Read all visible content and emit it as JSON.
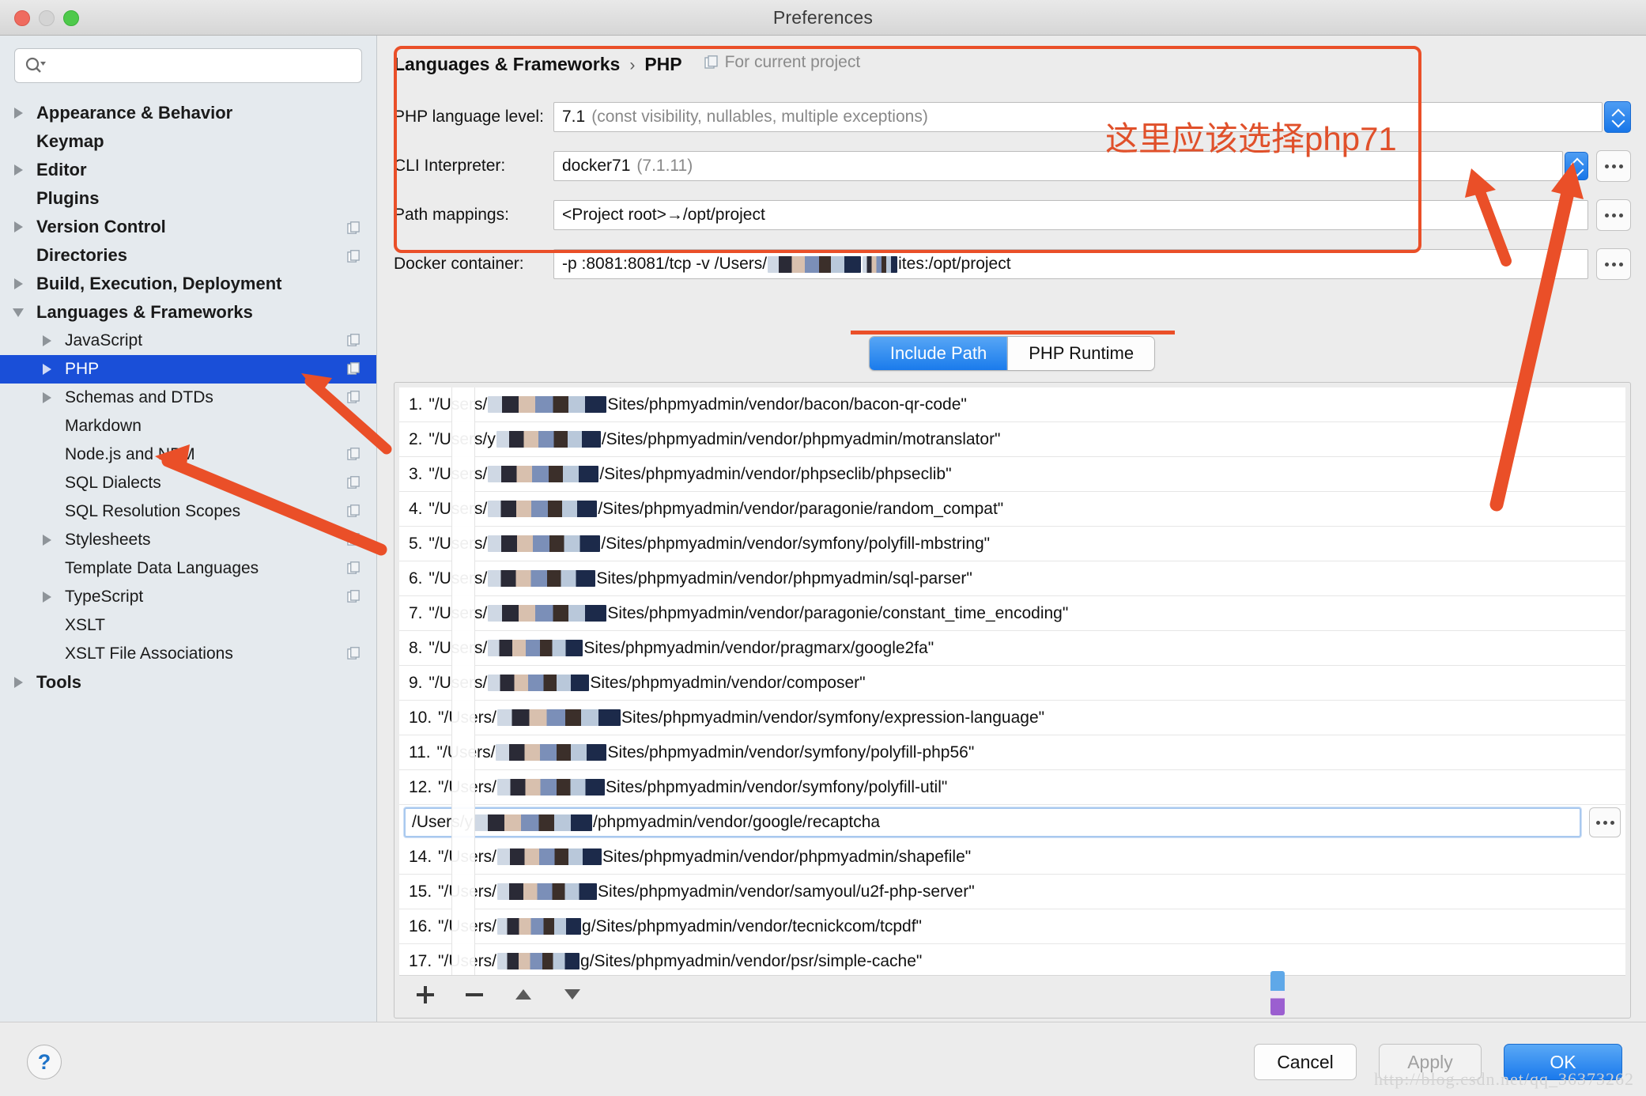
{
  "window": {
    "title": "Preferences",
    "traffic_lights": [
      "close-button",
      "minimize-button",
      "zoom-button"
    ]
  },
  "search": {
    "placeholder": "",
    "value": ""
  },
  "sidebar": {
    "items": [
      {
        "label": "Appearance & Behavior",
        "level": 0,
        "bold": true,
        "twisty": "right",
        "selected": false,
        "badge": false
      },
      {
        "label": "Keymap",
        "level": 0,
        "bold": true,
        "twisty": "none",
        "selected": false,
        "badge": false
      },
      {
        "label": "Editor",
        "level": 0,
        "bold": true,
        "twisty": "right",
        "selected": false,
        "badge": false
      },
      {
        "label": "Plugins",
        "level": 0,
        "bold": true,
        "twisty": "none",
        "selected": false,
        "badge": false
      },
      {
        "label": "Version Control",
        "level": 0,
        "bold": true,
        "twisty": "right",
        "selected": false,
        "badge": true
      },
      {
        "label": "Directories",
        "level": 0,
        "bold": true,
        "twisty": "none",
        "selected": false,
        "badge": true
      },
      {
        "label": "Build, Execution, Deployment",
        "level": 0,
        "bold": true,
        "twisty": "right",
        "selected": false,
        "badge": false
      },
      {
        "label": "Languages & Frameworks",
        "level": 0,
        "bold": true,
        "twisty": "down",
        "selected": false,
        "badge": false
      },
      {
        "label": "JavaScript",
        "level": 1,
        "bold": false,
        "twisty": "right",
        "selected": false,
        "badge": true
      },
      {
        "label": "PHP",
        "level": 1,
        "bold": false,
        "twisty": "right",
        "selected": true,
        "badge": true
      },
      {
        "label": "Schemas and DTDs",
        "level": 1,
        "bold": false,
        "twisty": "right",
        "selected": false,
        "badge": true
      },
      {
        "label": "Markdown",
        "level": 1,
        "bold": false,
        "twisty": "none",
        "selected": false,
        "badge": false
      },
      {
        "label": "Node.js and NPM",
        "level": 1,
        "bold": false,
        "twisty": "none",
        "selected": false,
        "badge": true
      },
      {
        "label": "SQL Dialects",
        "level": 1,
        "bold": false,
        "twisty": "none",
        "selected": false,
        "badge": true
      },
      {
        "label": "SQL Resolution Scopes",
        "level": 1,
        "bold": false,
        "twisty": "none",
        "selected": false,
        "badge": true
      },
      {
        "label": "Stylesheets",
        "level": 1,
        "bold": false,
        "twisty": "right",
        "selected": false,
        "badge": true
      },
      {
        "label": "Template Data Languages",
        "level": 1,
        "bold": false,
        "twisty": "none",
        "selected": false,
        "badge": true
      },
      {
        "label": "TypeScript",
        "level": 1,
        "bold": false,
        "twisty": "right",
        "selected": false,
        "badge": true
      },
      {
        "label": "XSLT",
        "level": 1,
        "bold": false,
        "twisty": "none",
        "selected": false,
        "badge": false
      },
      {
        "label": "XSLT File Associations",
        "level": 1,
        "bold": false,
        "twisty": "none",
        "selected": false,
        "badge": true
      },
      {
        "label": "Tools",
        "level": 0,
        "bold": true,
        "twisty": "right",
        "selected": false,
        "badge": false
      }
    ]
  },
  "breadcrumb": {
    "parent": "Languages & Frameworks",
    "separator": "›",
    "current": "PHP",
    "scope_note": "For current project"
  },
  "form": {
    "php_language_level": {
      "label": "PHP language level:",
      "value": "7.1",
      "value_detail": "(const visibility, nullables, multiple exceptions)"
    },
    "cli_interpreter": {
      "label": "CLI Interpreter:",
      "value": "docker71",
      "value_detail": "(7.1.11)"
    },
    "path_mappings": {
      "label": "Path mappings:",
      "value": "<Project root>→/opt/project"
    },
    "docker_container": {
      "label": "Docker container:",
      "value_prefix": "-p :8081:8081/tcp -v /Users/",
      "value_suffix": "ites:/opt/project"
    },
    "dots_label": "..."
  },
  "tabs": [
    {
      "label": "Include Path",
      "active": true
    },
    {
      "label": "PHP Runtime",
      "active": false
    }
  ],
  "include_path": {
    "rows": [
      {
        "num": "1.",
        "prefix": "\"/Users/",
        "suffix": "Sites/phpmyadmin/vendor/bacon/bacon-qr-code\"",
        "editing": false
      },
      {
        "num": "2.",
        "prefix": "\"/Users/y",
        "suffix": "/Sites/phpmyadmin/vendor/phpmyadmin/motranslator\"",
        "editing": false
      },
      {
        "num": "3.",
        "prefix": "\"/Users/",
        "suffix": "/Sites/phpmyadmin/vendor/phpseclib/phpseclib\"",
        "editing": false
      },
      {
        "num": "4.",
        "prefix": "\"/Users/",
        "suffix": "/Sites/phpmyadmin/vendor/paragonie/random_compat\"",
        "editing": false
      },
      {
        "num": "5.",
        "prefix": "\"/Users/",
        "suffix": "/Sites/phpmyadmin/vendor/symfony/polyfill-mbstring\"",
        "editing": false
      },
      {
        "num": "6.",
        "prefix": "\"/Users/",
        "suffix": "Sites/phpmyadmin/vendor/phpmyadmin/sql-parser\"",
        "editing": false
      },
      {
        "num": "7.",
        "prefix": "\"/Users/",
        "suffix": "Sites/phpmyadmin/vendor/paragonie/constant_time_encoding\"",
        "editing": false
      },
      {
        "num": "8.",
        "prefix": "\"/Users/",
        "suffix": "Sites/phpmyadmin/vendor/pragmarx/google2fa\"",
        "editing": false
      },
      {
        "num": "9.",
        "prefix": "\"/Users/",
        "suffix": "Sites/phpmyadmin/vendor/composer\"",
        "editing": false
      },
      {
        "num": "10.",
        "prefix": "\"/Users/",
        "suffix": "Sites/phpmyadmin/vendor/symfony/expression-language\"",
        "editing": false
      },
      {
        "num": "11.",
        "prefix": "\"/Users/",
        "suffix": "Sites/phpmyadmin/vendor/symfony/polyfill-php56\"",
        "editing": false
      },
      {
        "num": "12.",
        "prefix": "\"/Users/",
        "suffix": "Sites/phpmyadmin/vendor/symfony/polyfill-util\"",
        "editing": false
      },
      {
        "num": "",
        "prefix": "/Users/y",
        "suffix": "/phpmyadmin/vendor/google/recaptcha",
        "editing": true
      },
      {
        "num": "14.",
        "prefix": "\"/Users/",
        "suffix": "Sites/phpmyadmin/vendor/phpmyadmin/shapefile\"",
        "editing": false
      },
      {
        "num": "15.",
        "prefix": "\"/Users/",
        "suffix": "Sites/phpmyadmin/vendor/samyoul/u2f-php-server\"",
        "editing": false
      },
      {
        "num": "16.",
        "prefix": "\"/Users/",
        "suffix": "g/Sites/phpmyadmin/vendor/tecnickcom/tcpdf\"",
        "editing": false
      },
      {
        "num": "17.",
        "prefix": "\"/Users/",
        "suffix": "g/Sites/phpmyadmin/vendor/psr/simple-cache\"",
        "editing": false
      }
    ],
    "toolbar": [
      "add-icon",
      "remove-icon",
      "move-up-icon",
      "move-down-icon"
    ]
  },
  "footer": {
    "help_label": "?",
    "cancel_label": "Cancel",
    "apply_label": "Apply",
    "ok_label": "OK"
  },
  "annotations": {
    "note_text": "这里应该选择php71",
    "color": "#ea4f28"
  },
  "watermark": {
    "text": "http://blog.csdn.net/qq_36373262"
  },
  "colors": {
    "selection_blue": "#1a4fd8",
    "accent_blue": "#1a79ec",
    "annotation_orange": "#ea4f28",
    "sidebar_bg": "#e5eaee",
    "pane_bg": "#ececec"
  }
}
